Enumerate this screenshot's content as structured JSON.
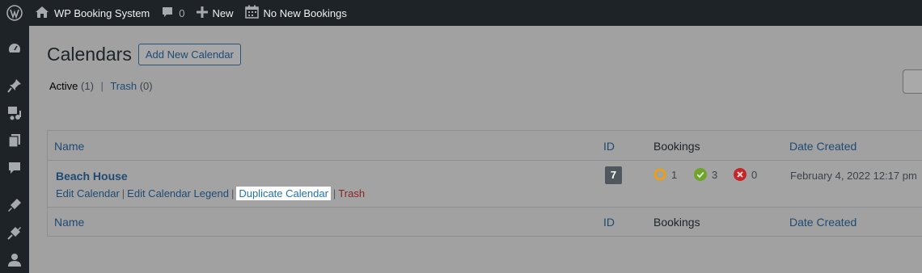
{
  "adminbar": {
    "site_name": "WP Booking System",
    "comments_count": "0",
    "new_label": "New",
    "bookings_label": "No New Bookings"
  },
  "sidebar": {
    "icons": [
      "dashboard-icon",
      "pin-icon",
      "media-icon",
      "pages-icon",
      "comments-icon",
      "appearance-icon",
      "plugins-icon",
      "users-icon"
    ]
  },
  "page": {
    "title": "Calendars",
    "add_button": "Add New Calendar"
  },
  "filters": {
    "active_label": "Active",
    "active_count": "(1)",
    "separator": "|",
    "trash_label": "Trash",
    "trash_count": "(0)"
  },
  "table": {
    "columns": [
      "Name",
      "ID",
      "Bookings",
      "Date Created"
    ],
    "rows": [
      {
        "name": "Beach House",
        "id": "7",
        "pending": "1",
        "accepted": "3",
        "rejected": "0",
        "date": "February 4, 2022 12:17 pm",
        "actions": [
          "Edit Calendar",
          "Edit Calendar Legend",
          "Duplicate Calendar",
          "Trash"
        ]
      }
    ]
  },
  "colors": {
    "pending": "#f0a000",
    "accepted": "#6fa32a",
    "rejected": "#c3272a",
    "link": "#1f4a73"
  }
}
